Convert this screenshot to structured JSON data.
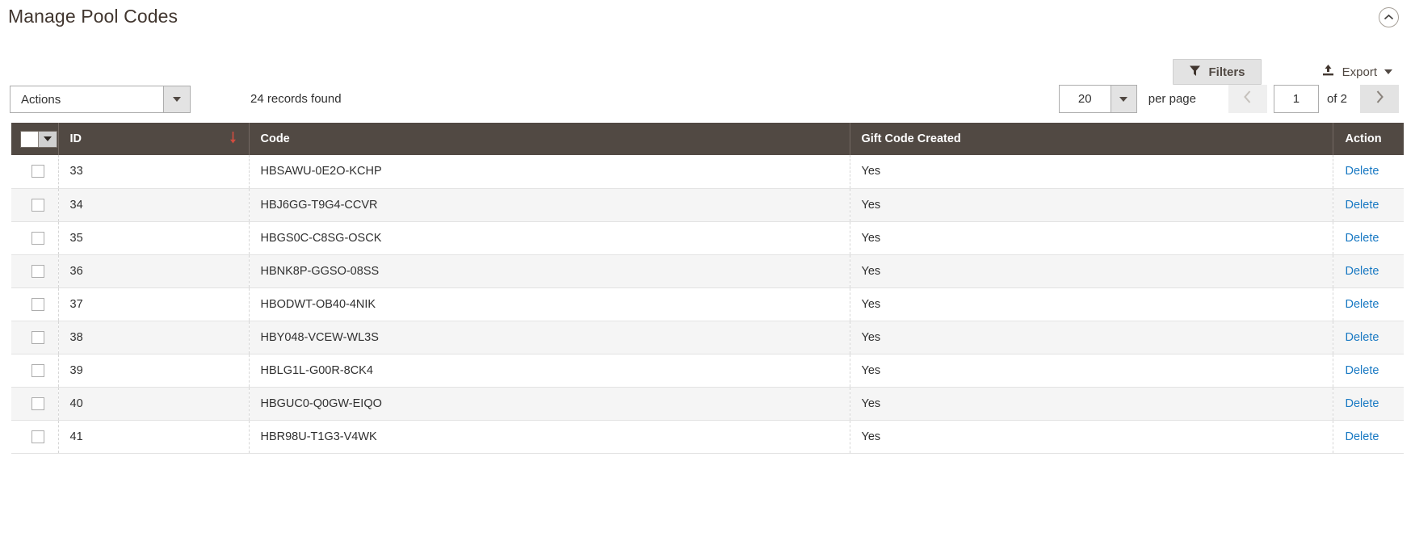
{
  "page": {
    "title": "Manage Pool Codes",
    "collapse_icon": "chevron-up-circle-icon"
  },
  "toolbar": {
    "filters_label": "Filters",
    "filters_icon": "funnel-icon",
    "export_label": "Export",
    "export_icon": "upload-icon",
    "export_caret_icon": "caret-down-icon"
  },
  "grid_toolbar": {
    "actions_label": "Actions",
    "actions_caret_icon": "caret-down-icon",
    "records_found": "24 records found",
    "per_page_value": "20",
    "per_page_caret_icon": "caret-down-icon",
    "per_page_label": "per page",
    "prev_icon": "chevron-left-icon",
    "next_icon": "chevron-right-icon",
    "current_page": "1",
    "total_pages_label": "of 2"
  },
  "grid": {
    "select_all_icon": "checkbox-dropdown-icon",
    "sort_arrow_icon": "arrow-down-icon",
    "sort_column": "ID",
    "sort_direction": "desc",
    "columns": [
      {
        "key": "select",
        "label": ""
      },
      {
        "key": "id",
        "label": "ID"
      },
      {
        "key": "code",
        "label": "Code"
      },
      {
        "key": "gift_code_created",
        "label": "Gift Code Created"
      },
      {
        "key": "action",
        "label": "Action"
      }
    ],
    "delete_label": "Delete",
    "rows": [
      {
        "id": "33",
        "code": "HBSAWU-0E2O-KCHP",
        "gift_code_created": "Yes",
        "action": "Delete"
      },
      {
        "id": "34",
        "code": "HBJ6GG-T9G4-CCVR",
        "gift_code_created": "Yes",
        "action": "Delete"
      },
      {
        "id": "35",
        "code": "HBGS0C-C8SG-OSCK",
        "gift_code_created": "Yes",
        "action": "Delete"
      },
      {
        "id": "36",
        "code": "HBNK8P-GGSO-08SS",
        "gift_code_created": "Yes",
        "action": "Delete"
      },
      {
        "id": "37",
        "code": "HBODWT-OB40-4NIK",
        "gift_code_created": "Yes",
        "action": "Delete"
      },
      {
        "id": "38",
        "code": "HBY048-VCEW-WL3S",
        "gift_code_created": "Yes",
        "action": "Delete"
      },
      {
        "id": "39",
        "code": "HBLG1L-G00R-8CK4",
        "gift_code_created": "Yes",
        "action": "Delete"
      },
      {
        "id": "40",
        "code": "HBGUC0-Q0GW-EIQO",
        "gift_code_created": "Yes",
        "action": "Delete"
      },
      {
        "id": "41",
        "code": "HBR98U-T1G3-V4WK",
        "gift_code_created": "Yes",
        "action": "Delete"
      }
    ]
  },
  "colors": {
    "header_bg": "#514943",
    "link_blue": "#1979c3",
    "sort_arrow": "#d24c3f",
    "stripe": "#f5f5f5"
  }
}
